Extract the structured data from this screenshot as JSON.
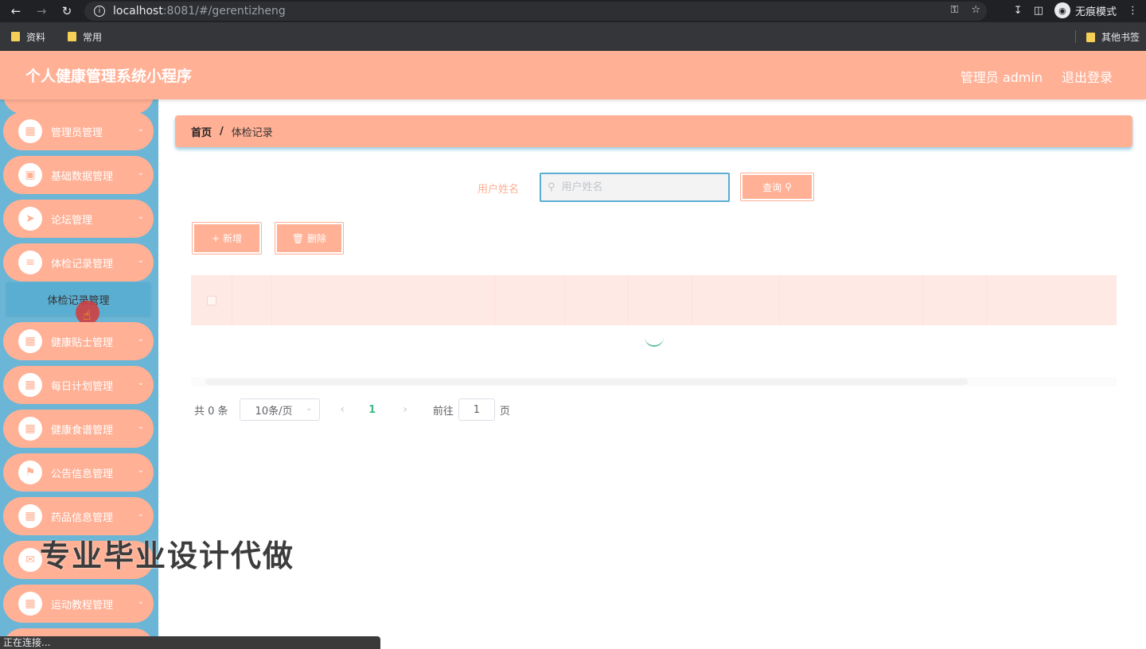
{
  "browser": {
    "url_host": "localhost",
    "url_rest": ":8081/#/gerentizheng",
    "incognito_label": "无痕模式",
    "bookmarks": [
      "资料",
      "常用"
    ],
    "bookmarks_other": "其他书签",
    "status": "正在连接..."
  },
  "header": {
    "title": "个人健康管理系统小程序",
    "user": "管理员 admin",
    "logout": "退出登录"
  },
  "sidebar": {
    "items": [
      {
        "label": "管理员管理",
        "icon": "grid-icon"
      },
      {
        "label": "基础数据管理",
        "icon": "box-icon"
      },
      {
        "label": "论坛管理",
        "icon": "send-icon"
      },
      {
        "label": "体检记录管理",
        "icon": "sliders-icon"
      },
      {
        "label": "健康贴士管理",
        "icon": "grid-icon"
      },
      {
        "label": "每日计划管理",
        "icon": "grid-icon"
      },
      {
        "label": "健康食谱管理",
        "icon": "grid-icon"
      },
      {
        "label": "公告信息管理",
        "icon": "flag-icon"
      },
      {
        "label": "药品信息管理",
        "icon": "grid-icon"
      },
      {
        "label": "",
        "icon": "chat-icon"
      },
      {
        "label": "运动教程管理",
        "icon": "grid-icon"
      }
    ],
    "submenu_label": "体检记录管理"
  },
  "breadcrumb": {
    "home": "首页",
    "separator": "/",
    "current": "体检记录"
  },
  "search": {
    "label": "用户姓名",
    "placeholder": "用户姓名",
    "query_button": "查询"
  },
  "actions": {
    "add": "新增",
    "delete": "删除"
  },
  "pagination": {
    "total": "共 0 条",
    "page_size": "10条/页",
    "current_page": "1",
    "goto_label": "前往",
    "goto_value": "1",
    "page_suffix": "页"
  },
  "overlay": {
    "watermark": "专业毕业设计代做"
  },
  "colors": {
    "accent": "#ffb095",
    "sidebar_bg": "#6bb6d6",
    "focus": "#5aaed2"
  }
}
